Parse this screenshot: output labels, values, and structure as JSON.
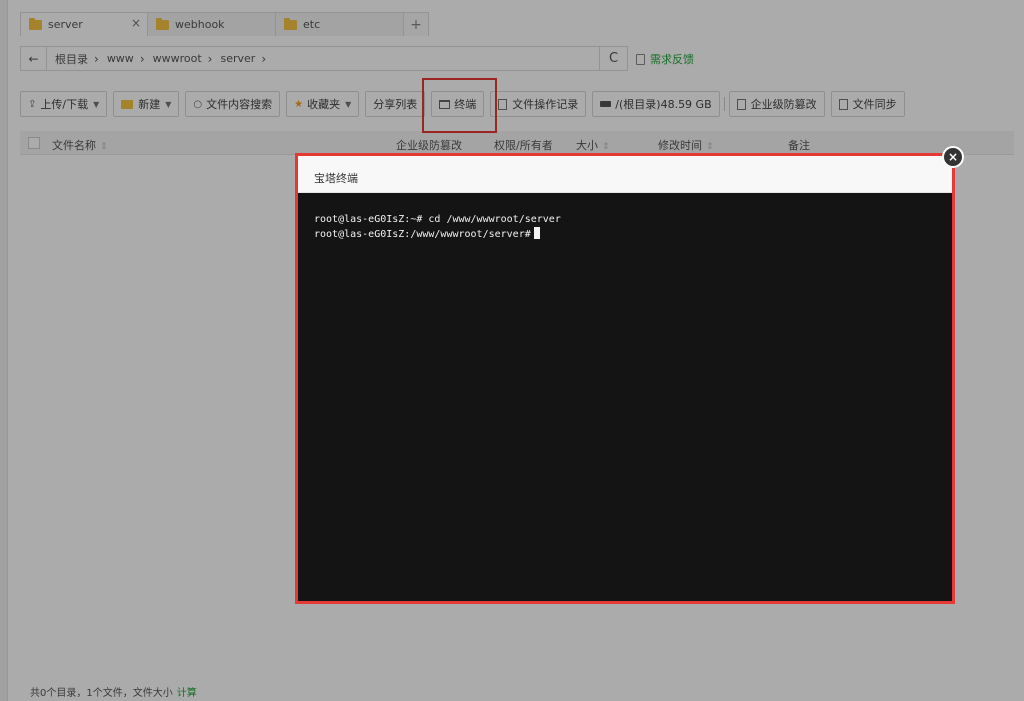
{
  "tabs": [
    {
      "label": "server",
      "close": "×"
    },
    {
      "label": "webhook"
    },
    {
      "label": "etc"
    }
  ],
  "tab_add": "+",
  "pathbar": {
    "back": "←",
    "crumbs": [
      "根目录",
      "www",
      "wwwroot",
      "server"
    ],
    "sep": "›",
    "refresh": "C"
  },
  "feedback": "需求反馈",
  "toolbar": {
    "upload": "上传/下载",
    "new": "新建",
    "search": "文件内容搜索",
    "favorites": "收藏夹",
    "share": "分享列表",
    "terminal": "终端",
    "oplog": "文件操作记录",
    "disk": "/(根目录)48.59 GB",
    "tamper": "企业级防篡改",
    "sync": "文件同步"
  },
  "table_header": {
    "name": "文件名称",
    "tamper": "企业级防篡改",
    "perm": "权限/所有者",
    "size": "大小",
    "mtime": "修改时间",
    "note": "备注"
  },
  "footer": {
    "summary": "共0个目录，1个文件，文件大小",
    "calc": "计算"
  },
  "modal": {
    "title": "宝塔终端",
    "close": "×",
    "lines": [
      "root@las-eG0IsZ:~# cd /www/wwwroot/server",
      "root@las-eG0IsZ:/www/wwwroot/server#"
    ]
  }
}
